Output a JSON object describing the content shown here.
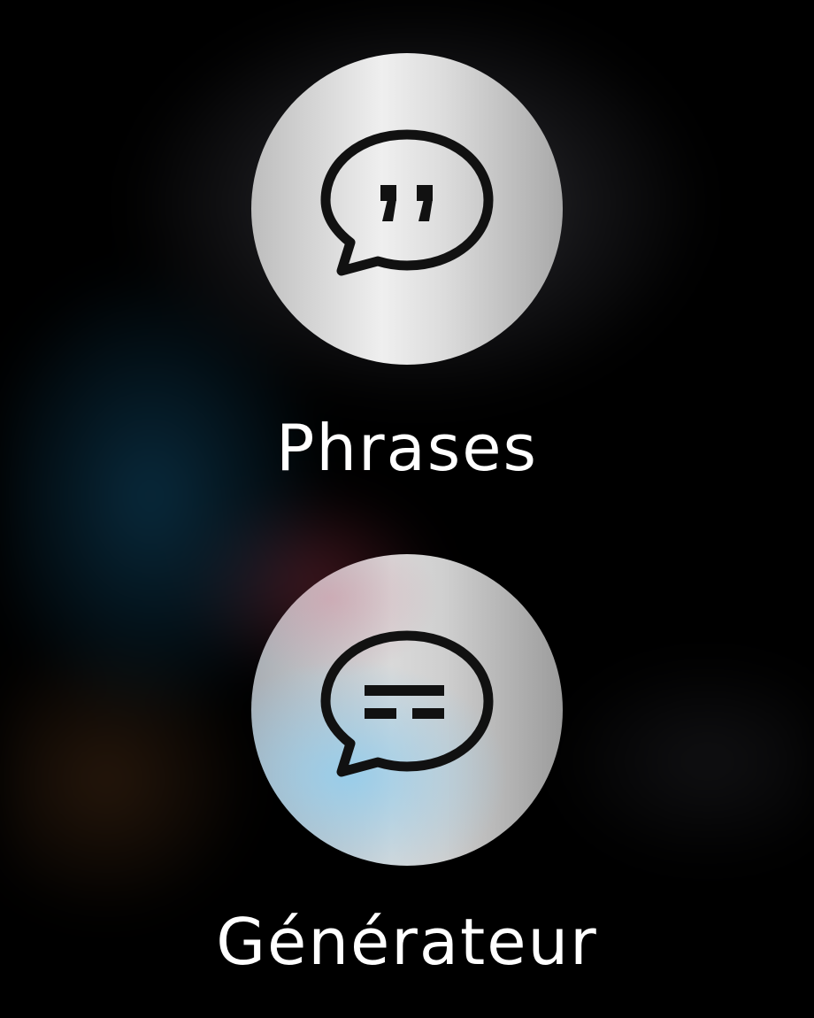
{
  "actions": [
    {
      "label": "Phrases",
      "icon": "quote-bubble-icon"
    },
    {
      "label": "Générateur",
      "icon": "text-lines-bubble-icon"
    }
  ]
}
